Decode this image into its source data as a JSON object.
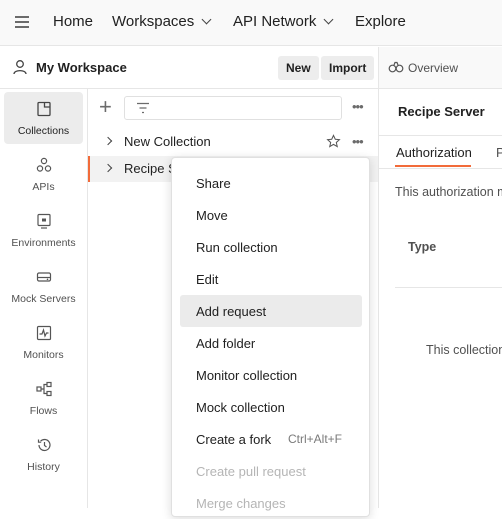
{
  "topbar": {
    "menu_icon": "hamburger-icon",
    "nav": [
      "Home",
      "Workspaces",
      "API Network",
      "Explore"
    ]
  },
  "workspace": {
    "title": "My Workspace",
    "new_label": "New",
    "import_label": "Import"
  },
  "sidebar": {
    "items": [
      {
        "label": "Collections",
        "icon": "collections-icon",
        "active": true
      },
      {
        "label": "APIs",
        "icon": "apis-icon"
      },
      {
        "label": "Environments",
        "icon": "environments-icon"
      },
      {
        "label": "Mock Servers",
        "icon": "mock-servers-icon"
      },
      {
        "label": "Monitors",
        "icon": "monitors-icon"
      },
      {
        "label": "Flows",
        "icon": "flows-icon"
      },
      {
        "label": "History",
        "icon": "history-icon"
      }
    ]
  },
  "collections": {
    "items": [
      {
        "name": "New Collection"
      },
      {
        "name": "Recipe Server",
        "visible_text": "Recipe S",
        "selected": true
      }
    ]
  },
  "context_menu": {
    "items": [
      {
        "label": "Share"
      },
      {
        "label": "Move"
      },
      {
        "label": "Run collection"
      },
      {
        "label": "Edit"
      },
      {
        "label": "Add request",
        "hovered": true
      },
      {
        "label": "Add folder"
      },
      {
        "label": "Monitor collection"
      },
      {
        "label": "Mock collection"
      },
      {
        "label": "Create a fork",
        "shortcut": "Ctrl+Alt+F"
      },
      {
        "label": "Create pull request",
        "disabled": true
      },
      {
        "label": "Merge changes",
        "disabled": true
      }
    ]
  },
  "right_panel": {
    "overview_tab": "Overview",
    "title": "Recipe Server",
    "tabs": [
      "Authorization",
      "P"
    ],
    "auth_text": "This authorization m",
    "type_label": "Type",
    "body_text": "This collection"
  },
  "colors": {
    "accent": "#f26b3a",
    "menu_hover": "#ebebeb",
    "active_tile": "#ececec"
  }
}
